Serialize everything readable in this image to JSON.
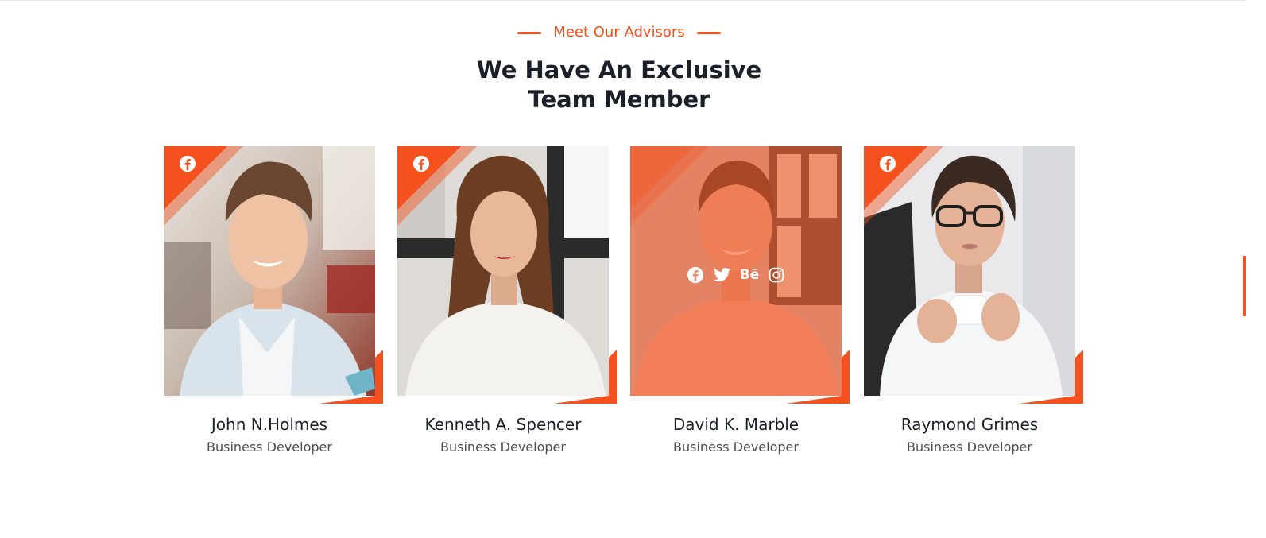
{
  "section": {
    "subtitle": "Meet Our Advisors",
    "heading_line1": "We Have An Exclusive",
    "heading_line2": "Team Member"
  },
  "colors": {
    "accent": "#f4511e",
    "heading": "#1b1f2a",
    "text": "#4d4d4d"
  },
  "team": [
    {
      "name": "John N.Holmes",
      "role": "Business Developer",
      "corner_icon": "facebook-icon"
    },
    {
      "name": "Kenneth A. Spencer",
      "role": "Business Developer",
      "corner_icon": "facebook-icon"
    },
    {
      "name": "David K. Marble",
      "role": "Business Developer",
      "hovered": true,
      "socials": [
        "facebook-icon",
        "twitter-icon",
        "behance-icon",
        "instagram-icon"
      ],
      "behance_text": "Bē"
    },
    {
      "name": "Raymond Grimes",
      "role": "Business Developer",
      "corner_icon": "facebook-icon"
    }
  ]
}
